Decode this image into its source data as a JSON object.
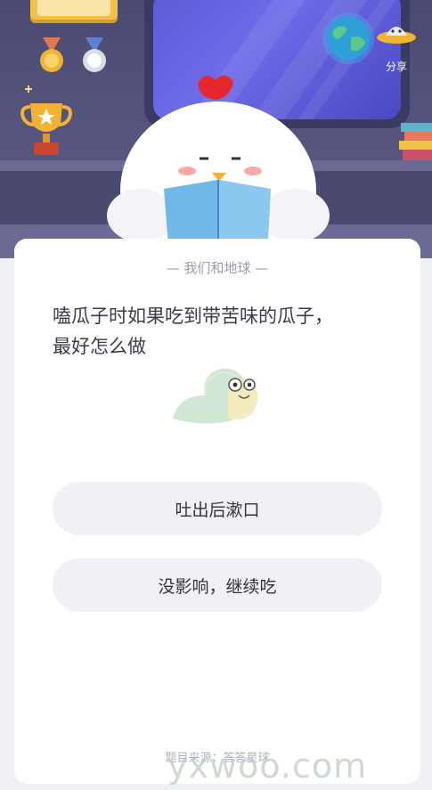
{
  "header": {
    "share_label": "分享"
  },
  "card": {
    "category": "— 我们和地球 —",
    "question_line1": "嗑瓜子时如果吃到带苦味的瓜子，",
    "question_line2": "最好怎么做",
    "answers": [
      {
        "label": "吐出后漱口"
      },
      {
        "label": "没影响，继续吃"
      }
    ],
    "footer": "题目来源：答答星球"
  },
  "watermark": "yxwoo.com",
  "colors": {
    "header_bg": "#55557f",
    "card_bg": "#ffffff",
    "answer_bg": "#f0f1f5",
    "window_glass": "#6d6be8"
  }
}
